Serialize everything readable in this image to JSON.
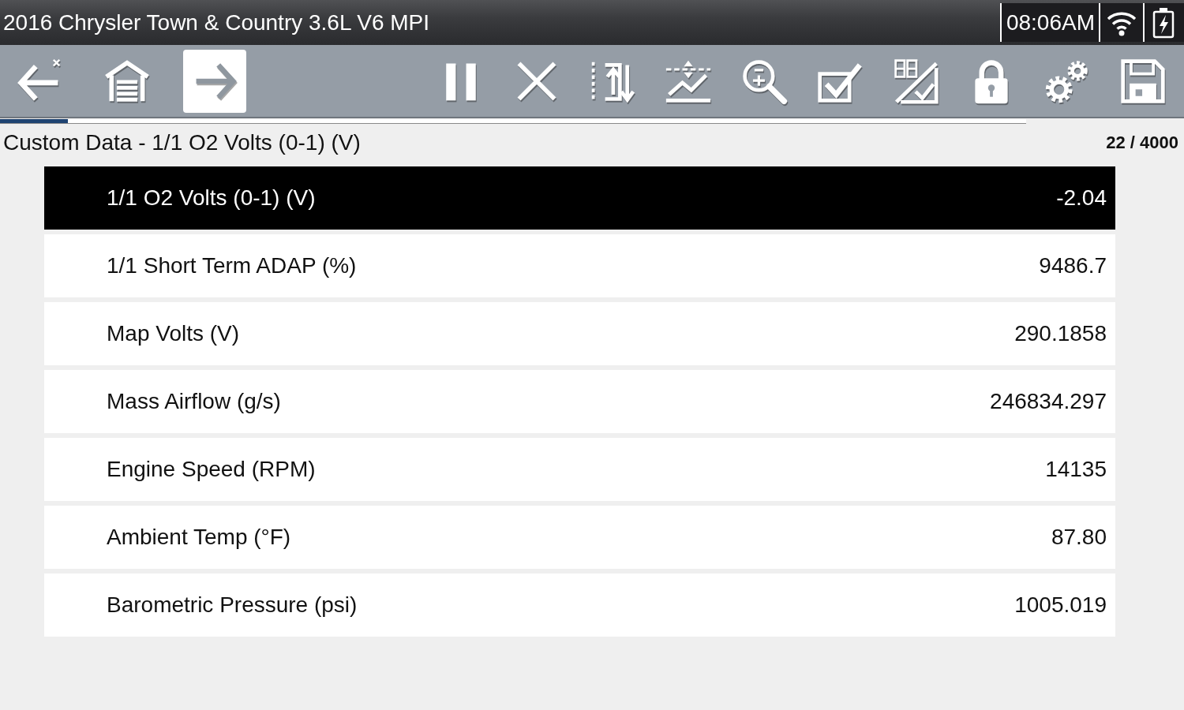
{
  "title_bar": {
    "title": "2016 Chrysler Town & Country 3.6L V6 MPI",
    "time": "08:06AM"
  },
  "toolbar": {
    "nav_buttons": [
      {
        "kind": "back",
        "selected": false
      },
      {
        "kind": "home",
        "selected": false
      },
      {
        "kind": "forward",
        "selected": true
      }
    ],
    "tool_buttons": [
      {
        "kind": "pause"
      },
      {
        "kind": "stop"
      },
      {
        "kind": "sort"
      },
      {
        "kind": "threshold"
      },
      {
        "kind": "zoom"
      },
      {
        "kind": "select"
      },
      {
        "kind": "display"
      },
      {
        "kind": "lock"
      },
      {
        "kind": "settings"
      },
      {
        "kind": "save"
      }
    ]
  },
  "buffer": {
    "level": 0.066
  },
  "header": {
    "title": "Custom Data - 1/1 O2 Volts (0-1) (V)",
    "counter": "22 / 4000"
  },
  "rows": [
    {
      "name": "1/1 O2 Volts (0-1) (V)",
      "value": "-2.04",
      "selected": true
    },
    {
      "name": "1/1 Short Term ADAP (%)",
      "value": "9486.7",
      "selected": false
    },
    {
      "name": "Map Volts (V)",
      "value": "290.1858",
      "selected": false
    },
    {
      "name": "Mass Airflow (g/s)",
      "value": "246834.297",
      "selected": false
    },
    {
      "name": "Engine Speed (RPM)",
      "value": "14135",
      "selected": false
    },
    {
      "name": "Ambient Temp (°F)",
      "value": "87.80",
      "selected": false
    },
    {
      "name": "Barometric Pressure (psi)",
      "value": "1005.019",
      "selected": false
    }
  ]
}
